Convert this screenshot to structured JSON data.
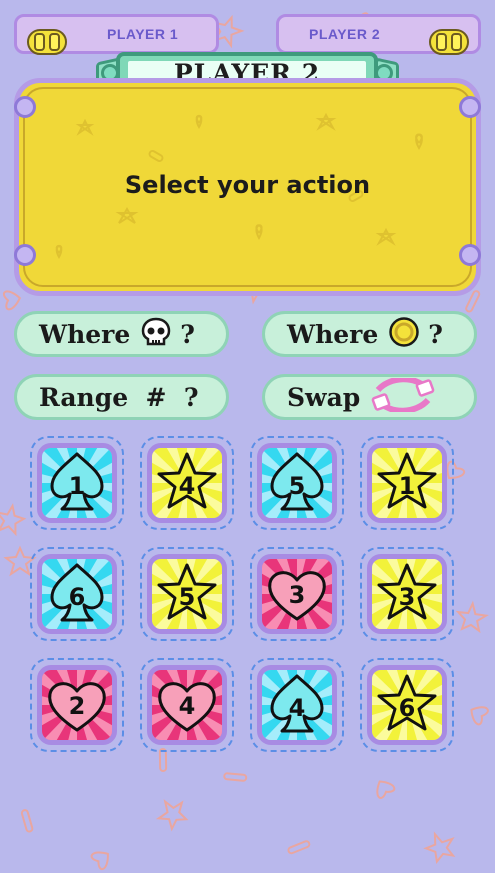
{
  "players": [
    {
      "label": "PLAYER 1"
    },
    {
      "label": "PLAYER 2"
    }
  ],
  "banner": {
    "title": "PLAYER 2"
  },
  "board": {
    "message": "Select your action"
  },
  "actions": {
    "where_skull": {
      "label": "Where",
      "icon": "skull-icon",
      "q": "?"
    },
    "where_coin": {
      "label": "Where",
      "icon": "coin-icon",
      "q": "?"
    },
    "range": {
      "label": "Range  #  ?"
    },
    "swap": {
      "label": "Swap",
      "icon": "swap-arrows-icon"
    }
  },
  "colors": {
    "background": "#b9b8ec",
    "board": "#f0d838",
    "pill": "#c8f0da",
    "spade_tile": "#35d8f0",
    "star_tile": "#f2f23a",
    "heart_tile": "#e8357a"
  },
  "cards": [
    {
      "suit": "spade",
      "number": "1"
    },
    {
      "suit": "star",
      "number": "4"
    },
    {
      "suit": "spade",
      "number": "5"
    },
    {
      "suit": "star",
      "number": "1"
    },
    {
      "suit": "spade",
      "number": "6"
    },
    {
      "suit": "star",
      "number": "5"
    },
    {
      "suit": "heart",
      "number": "3"
    },
    {
      "suit": "star",
      "number": "3"
    },
    {
      "suit": "heart",
      "number": "2"
    },
    {
      "suit": "heart",
      "number": "4"
    },
    {
      "suit": "spade",
      "number": "4"
    },
    {
      "suit": "star",
      "number": "6"
    }
  ]
}
